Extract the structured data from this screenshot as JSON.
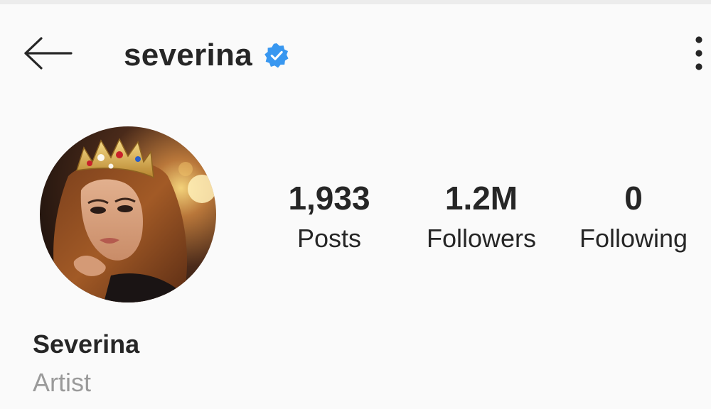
{
  "header": {
    "username": "severina",
    "verified": true,
    "back_icon": "arrow-left-icon",
    "more_icon": "more-vertical-icon",
    "badge_color": "#3897f0"
  },
  "profile": {
    "avatar_description_icon": "profile-photo",
    "stats": {
      "posts": {
        "value": "1,933",
        "label": "Posts"
      },
      "followers": {
        "value": "1.2M",
        "label": "Followers"
      },
      "following": {
        "value": "0",
        "label": "Following"
      }
    },
    "display_name": "Severina",
    "category": "Artist"
  }
}
